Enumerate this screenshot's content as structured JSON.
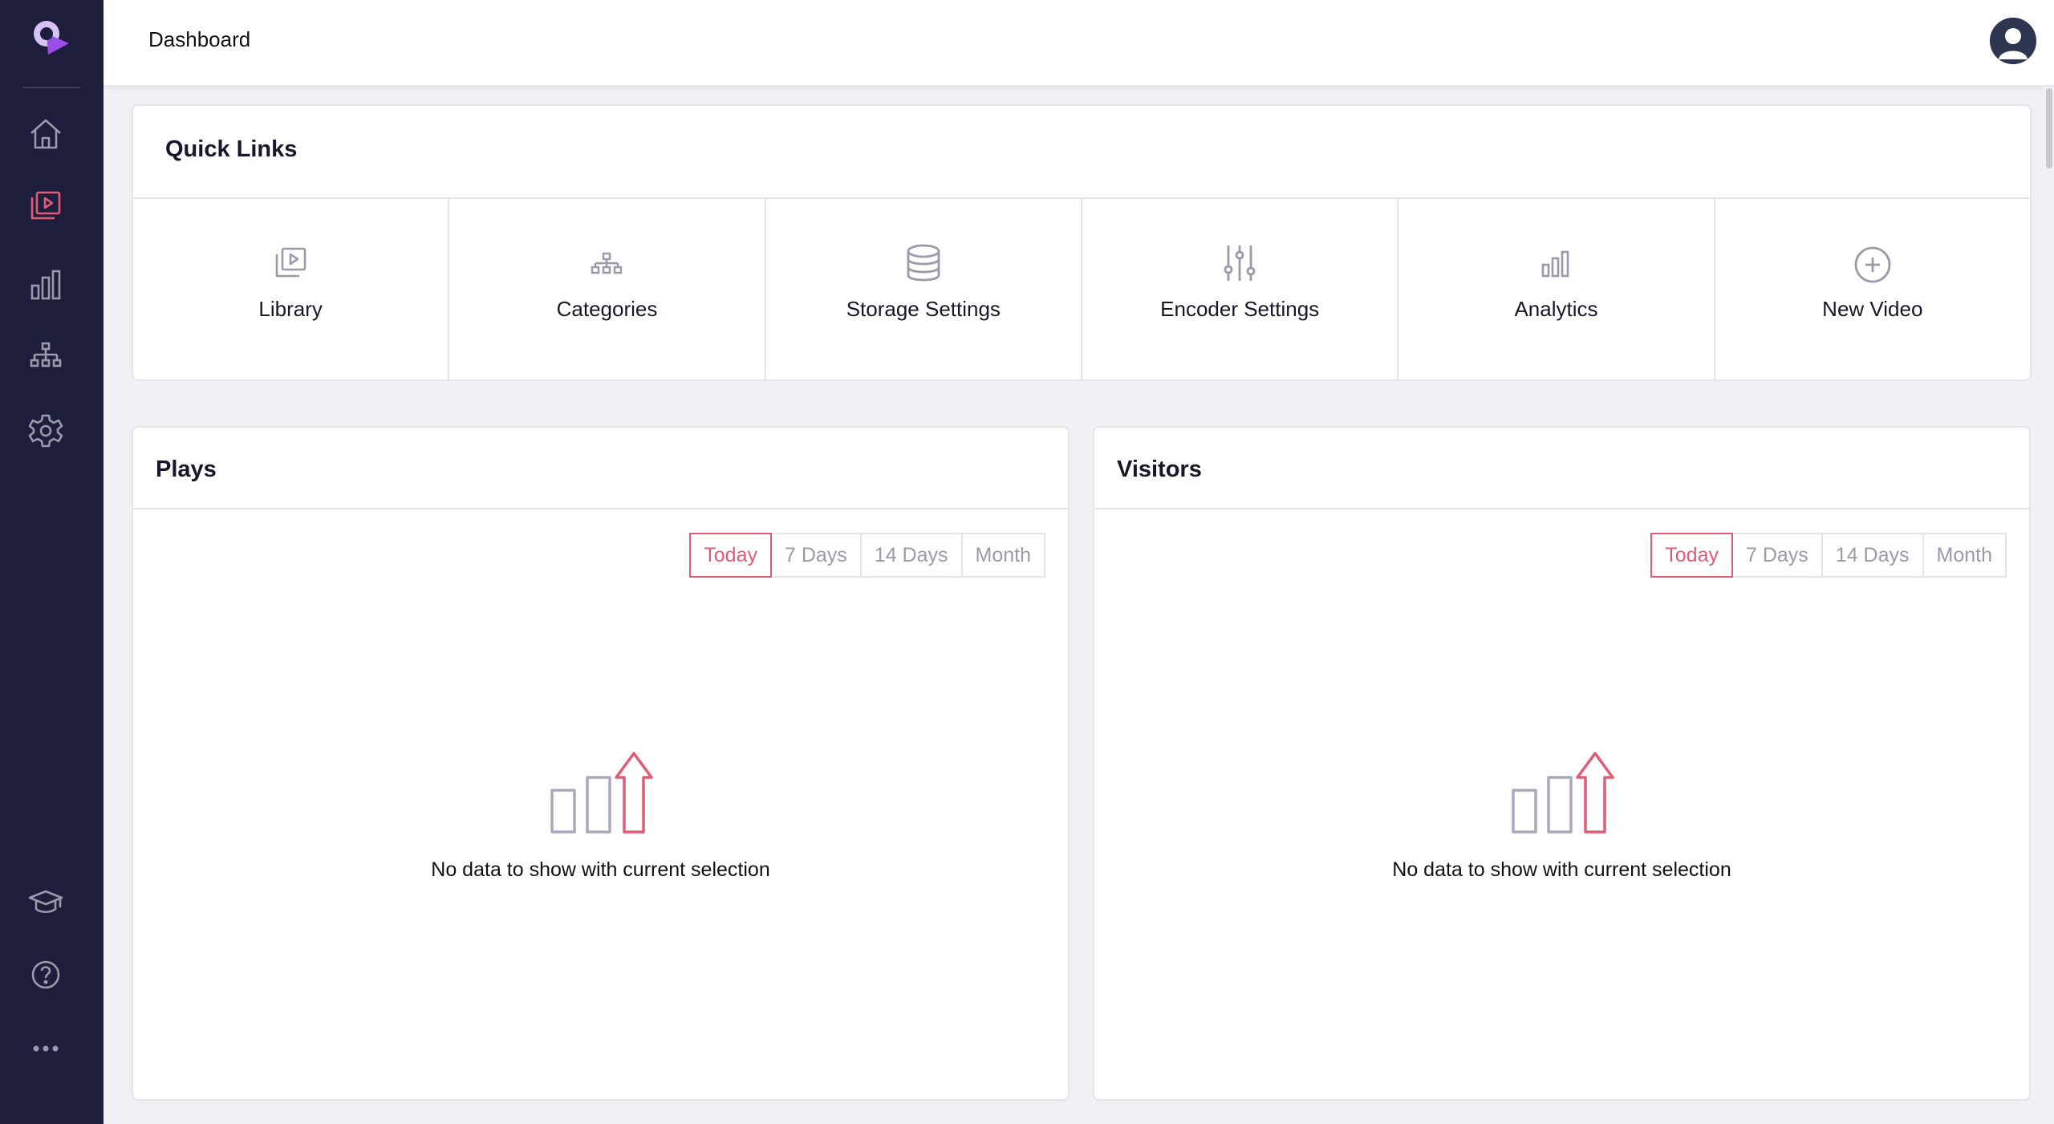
{
  "header": {
    "title": "Dashboard"
  },
  "sidebar": {
    "items": [
      {
        "icon": "home-icon"
      },
      {
        "icon": "video-library-icon"
      },
      {
        "icon": "bar-chart-icon"
      },
      {
        "icon": "hierarchy-icon"
      },
      {
        "icon": "gear-icon"
      },
      {
        "icon": "graduation-cap-icon"
      },
      {
        "icon": "help-icon"
      },
      {
        "icon": "more-icon"
      }
    ]
  },
  "quick_links": {
    "title": "Quick Links",
    "items": [
      {
        "label": "Library",
        "icon": "video-library-icon"
      },
      {
        "label": "Categories",
        "icon": "hierarchy-icon"
      },
      {
        "label": "Storage Settings",
        "icon": "database-icon"
      },
      {
        "label": "Encoder Settings",
        "icon": "sliders-icon"
      },
      {
        "label": "Analytics",
        "icon": "bar-chart-icon"
      },
      {
        "label": "New Video",
        "icon": "plus-circle-icon"
      }
    ]
  },
  "panels": {
    "plays": {
      "title": "Plays",
      "ranges": [
        "Today",
        "7 Days",
        "14 Days",
        "Month"
      ],
      "active_range": "Today",
      "empty_text": "No data to show with current selection"
    },
    "visitors": {
      "title": "Visitors",
      "ranges": [
        "Today",
        "7 Days",
        "14 Days",
        "Month"
      ],
      "active_range": "Today",
      "empty_text": "No data to show with current selection"
    }
  },
  "colors": {
    "sidebar_bg": "#1d1d3c",
    "accent": "#e15a76",
    "brand": "#9b4dea",
    "icon_gray": "#9a9aab"
  }
}
